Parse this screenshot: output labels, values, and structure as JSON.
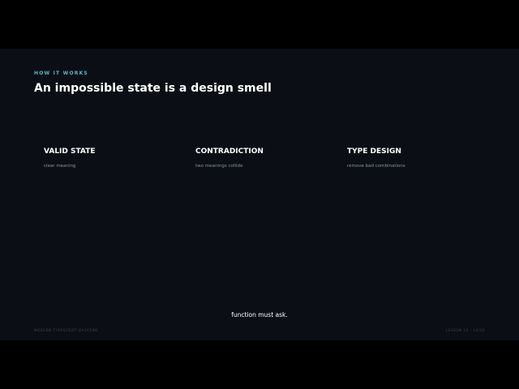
{
  "slide": {
    "eyebrow": "HOW IT WORKS",
    "title": "An impossible state is a design smell",
    "columns": [
      {
        "heading": "VALID STATE",
        "description": "clear meaning"
      },
      {
        "heading": "CONTRADICTION",
        "description": "two meanings collide"
      },
      {
        "heading": "TYPE DESIGN",
        "description": "remove bad combinations"
      }
    ],
    "caption": "function must ask.",
    "footer_left": "MODERN TYPESCRIPT BACKEND",
    "footer_right": "LESSON 05 · 10/20"
  },
  "colors": {
    "background": "#0b0e14",
    "accent": "#5fb3c9",
    "heading": "#ffffff",
    "muted": "#8a93a3"
  }
}
